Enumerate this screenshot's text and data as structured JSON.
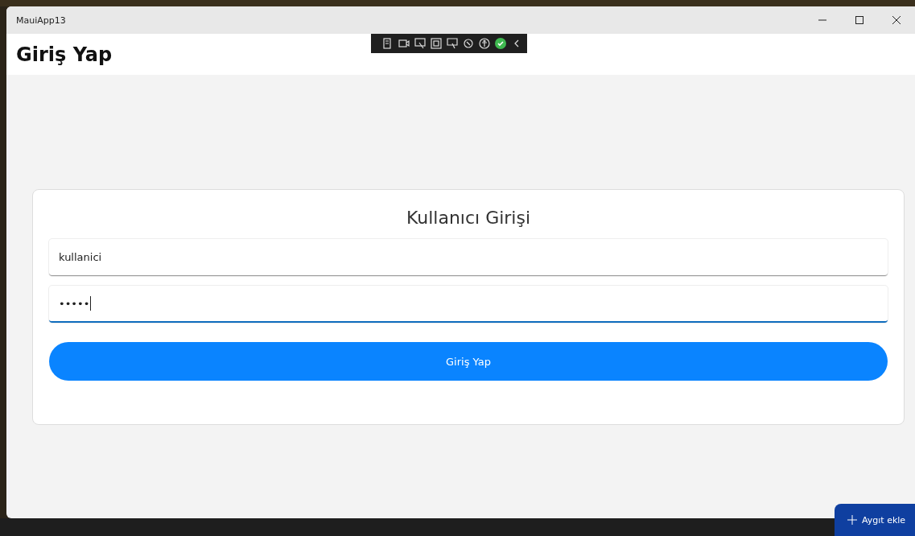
{
  "window": {
    "title": "MauiApp13"
  },
  "page": {
    "title": "Giriş Yap"
  },
  "login_card": {
    "heading": "Kullanıcı Girişi",
    "username": {
      "value": "kullanici",
      "focused": false
    },
    "password": {
      "value": "•••••",
      "focused": true
    },
    "submit": "Giriş Yap"
  },
  "add_device_button": "Aygıt ekle"
}
